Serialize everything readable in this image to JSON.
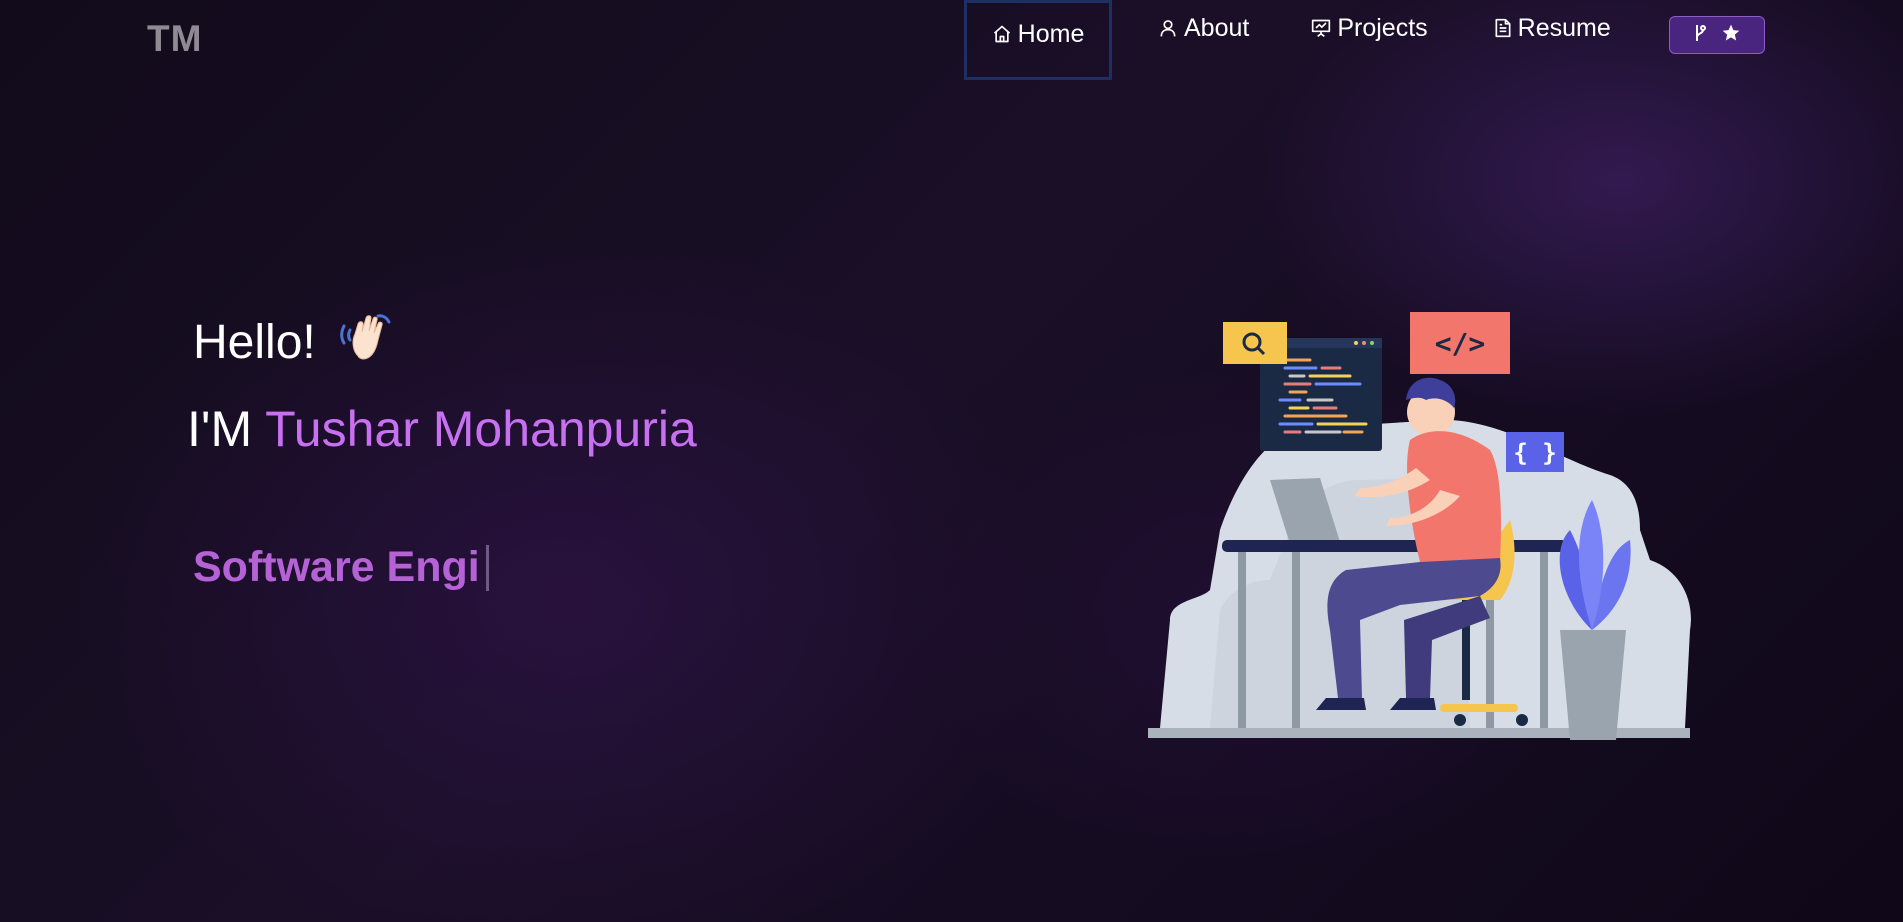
{
  "logo": {
    "text": "TM"
  },
  "nav": {
    "items": [
      {
        "label": "Home",
        "icon": "home-icon",
        "active": true
      },
      {
        "label": "About",
        "icon": "user-icon"
      },
      {
        "label": "Projects",
        "icon": "presentation-icon"
      },
      {
        "label": "Resume",
        "icon": "document-icon"
      }
    ],
    "fork_button": {
      "icons": [
        "git-fork-icon",
        "star-icon"
      ]
    }
  },
  "hero": {
    "greeting": "Hello!",
    "greeting_icon": "waving-hand-icon",
    "intro_prefix": "I'M",
    "name": "Tushar Mohanpuria",
    "typed_text": "Software Engi"
  },
  "colors": {
    "accent": "#c770f0",
    "typed": "#b562d6",
    "fork_button_bg": "#4a2580",
    "active_border": "#1d2f63"
  }
}
